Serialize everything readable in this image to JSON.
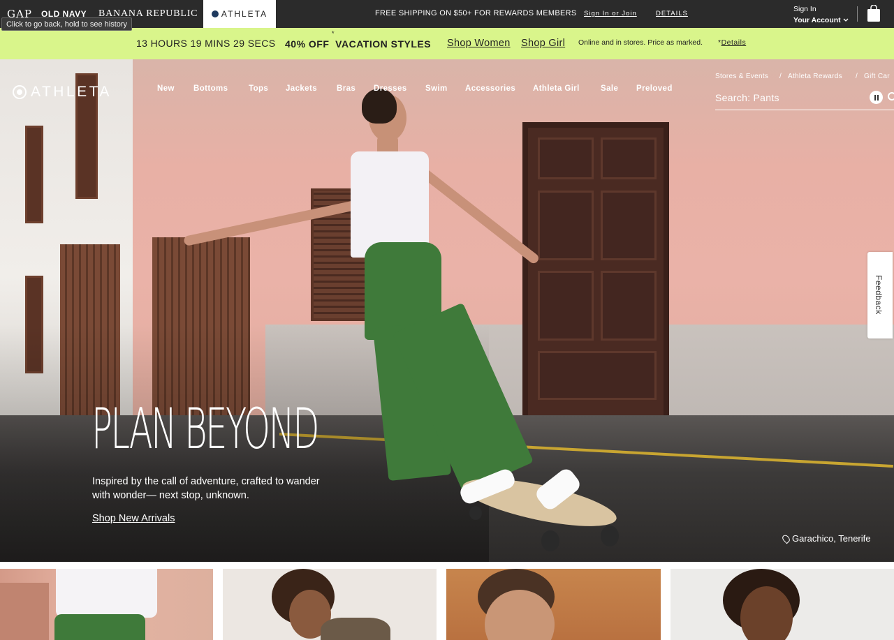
{
  "brandbar": {
    "brands": [
      "GAP",
      "OLD NAVY",
      "BANANA REPUBLIC",
      "ATHLETA"
    ],
    "tooltip": "Click to go back, hold to see history",
    "shipping_message": "FREE SHIPPING ON $50+ FOR REWARDS MEMBERS",
    "signin_join": "Sign In or Join",
    "details": "DETAILS",
    "sign_in": "Sign In",
    "your_account": "Your Account"
  },
  "promo": {
    "timer": "13 HOURS 19 MINS 29 SECS",
    "asterisk": "*",
    "offer": "40% OFF  VACATION STYLES",
    "shop_women": "Shop Women",
    "shop_girl": "Shop Girl",
    "fine_print": "Online and in stores. Price as marked.",
    "details_prefix": "*",
    "details": "Details"
  },
  "header": {
    "logo": "ATHLETA",
    "nav": [
      "New",
      "Bottoms",
      "Tops",
      "Jackets",
      "Bras",
      "Dresses",
      "Swim",
      "Accessories",
      "Athleta Girl",
      "Sale",
      "Preloved"
    ],
    "utility": [
      "Stores & Events",
      "/",
      "Athleta Rewards",
      "/",
      "Gift Car"
    ],
    "search_placeholder": "Search: Pants"
  },
  "hero": {
    "headline": "PLAN BEYOND",
    "subcopy": "Inspired by the call of adventure, crafted to wander with wonder— next stop, unknown.",
    "cta": "Shop New Arrivals",
    "location": "Garachico, Tenerife"
  },
  "feedback": "Feedback",
  "colors": {
    "brandbar_bg": "#2b2b2b",
    "promo_bg": "#d9f58b",
    "pants_green": "#3f7a3a"
  }
}
